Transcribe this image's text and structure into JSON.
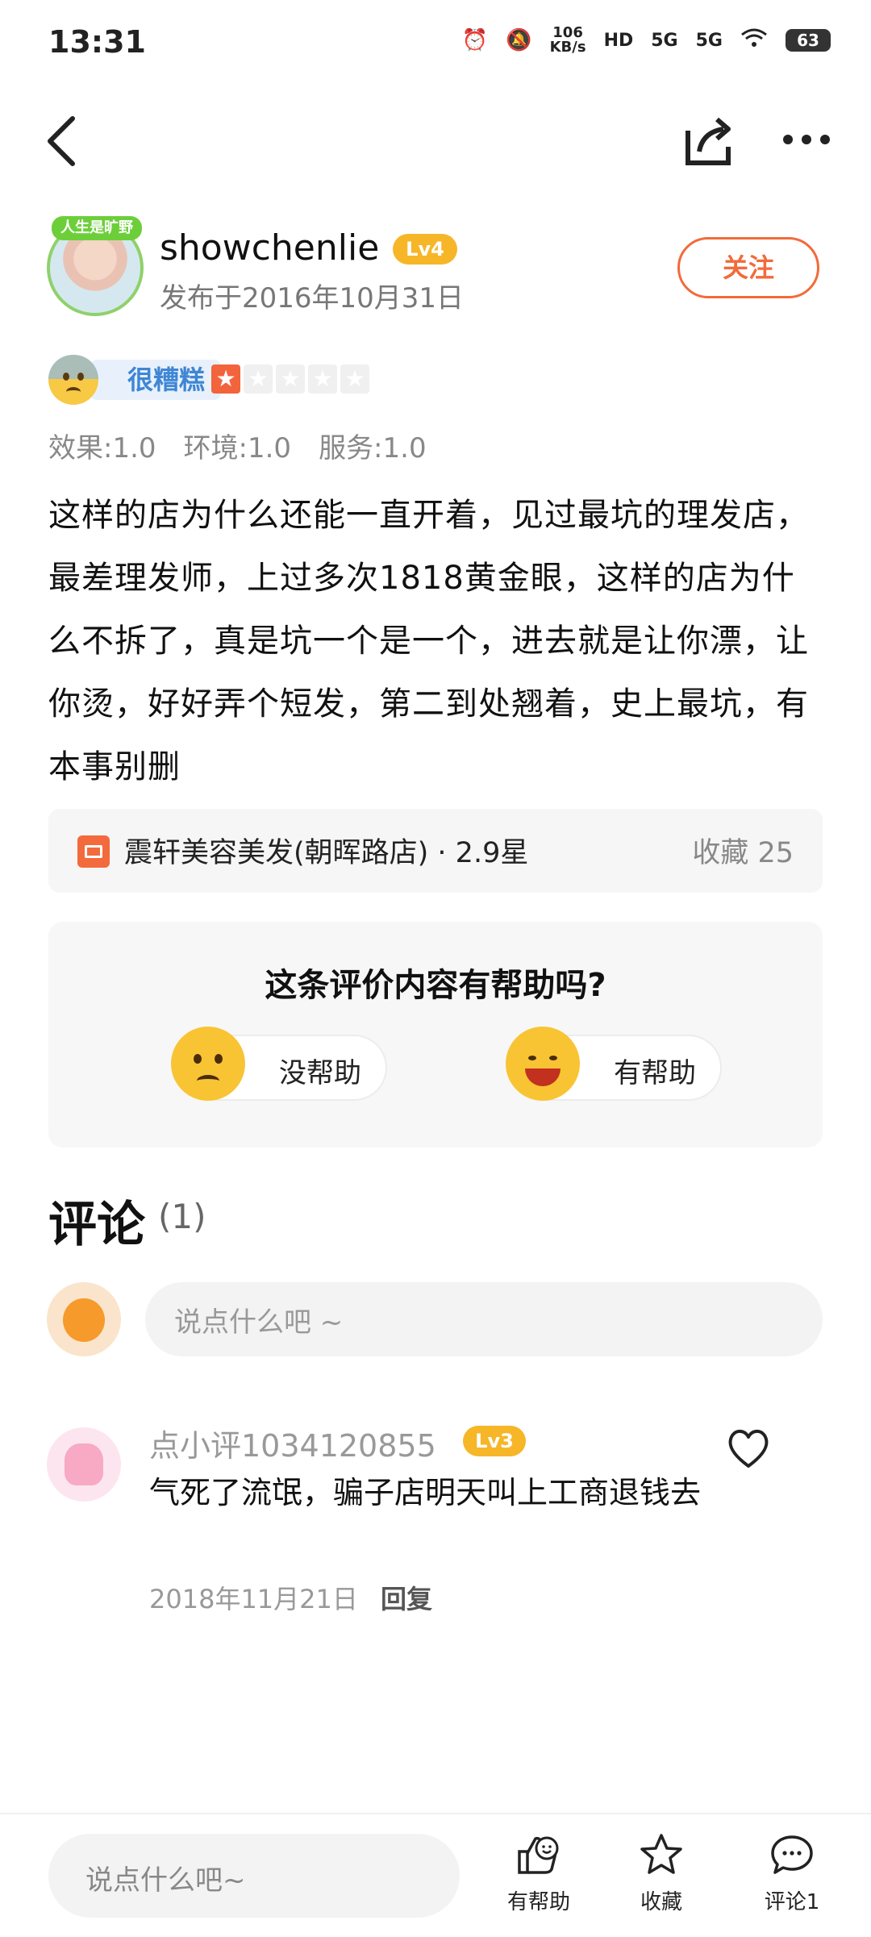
{
  "status_bar": {
    "time": "13:31",
    "net_speed": "106\nKB/s",
    "net_1": "5G",
    "net_2": "5G",
    "battery": "63"
  },
  "nav": {
    "back_icon": "back-arrow-icon",
    "share_icon": "share-icon",
    "more_icon": "more-icon"
  },
  "author": {
    "avatar_tag": "人生是旷野",
    "name": "showchenlie",
    "level": "Lv4",
    "published": "发布于2016年10月31日",
    "follow_label": "关注"
  },
  "rating": {
    "label": "很糟糕",
    "stars_filled": 1,
    "stars_total": 5,
    "scores": [
      "效果:1.0",
      "环境:1.0",
      "服务:1.0"
    ]
  },
  "review": {
    "text": "这样的店为什么还能一直开着，见过最坑的理发店，最差理发师，上过多次1818黄金眼，这样的店为什么不拆了，真是坑一个是一个，进去就是让你漂，让你烫，好好弄个短发，第二到处翘着，史上最坑，有本事别删"
  },
  "shop": {
    "name": "震轩美容美发(朝晖路店) · 2.9星",
    "favorites": "收藏 25"
  },
  "helpful": {
    "question": "这条评价内容有帮助吗?",
    "no_label": "没帮助",
    "yes_label": "有帮助"
  },
  "comments": {
    "title": "评论",
    "count": "(1)",
    "input_placeholder": "说点什么吧 ~",
    "items": [
      {
        "user": "点小评1034120855",
        "level": "Lv3",
        "text": "气死了流氓，骗子店明天叫上工商退钱去",
        "date": "2018年11月21日",
        "reply_label": "回复"
      }
    ]
  },
  "bottom_bar": {
    "input_placeholder": "说点什么吧~",
    "helpful_label": "有帮助",
    "favorite_label": "收藏",
    "comment_label": "评论1"
  },
  "colors": {
    "accent": "#f26b3a",
    "level_badge": "#f6b628",
    "rating_blue": "#3f86d4"
  }
}
